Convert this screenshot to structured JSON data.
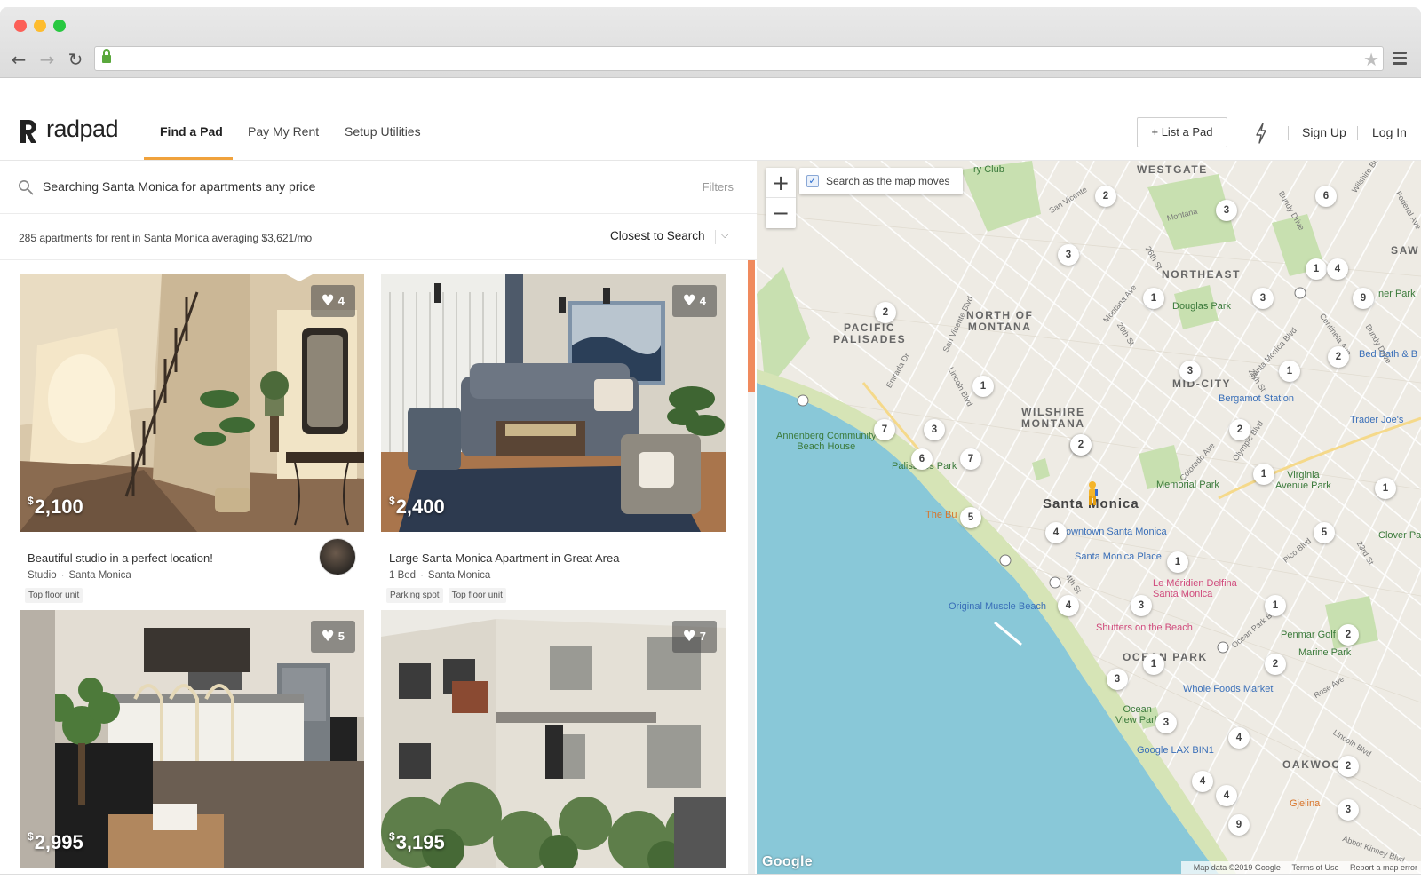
{
  "browser": {
    "url": "",
    "back_icon": "←",
    "forward_icon": "→",
    "reload_icon": "↻",
    "star_icon": "★"
  },
  "header": {
    "logo_text": "radpad",
    "nav": [
      {
        "label": "Find a Pad",
        "active": true
      },
      {
        "label": "Pay My Rent",
        "active": false
      },
      {
        "label": "Setup Utilities",
        "active": false
      }
    ],
    "list_button": "+ List a Pad",
    "sign_up": "Sign Up",
    "log_in": "Log In",
    "accent_color": "#f0a23c"
  },
  "search": {
    "text": "Searching Santa Monica for apartments any price",
    "filters_label": "Filters"
  },
  "summary": {
    "text": "285 apartments for rent in Santa Monica averaging $3,621/mo",
    "sort_label": "Closest to Search",
    "sort_chevron": "⌵"
  },
  "listings": [
    {
      "price_symbol": "$",
      "price": "2,100",
      "likes": "4",
      "title": "Beautiful studio in a perfect location!",
      "beds": "Studio",
      "area": "Santa Monica",
      "tags": [
        "Top floor unit"
      ],
      "has_agent": true
    },
    {
      "price_symbol": "$",
      "price": "2,400",
      "likes": "4",
      "title": "Large Santa Monica Apartment in Great Area",
      "beds": "1 Bed",
      "area": "Santa Monica",
      "tags": [
        "Parking spot",
        "Top floor unit"
      ],
      "has_agent": false
    },
    {
      "price_symbol": "$",
      "price": "2,995",
      "likes": "5",
      "title": "",
      "beds": "",
      "area": "",
      "tags": [],
      "has_agent": false
    },
    {
      "price_symbol": "$",
      "price": "3,195",
      "likes": "7",
      "title": "",
      "beds": "",
      "area": "",
      "tags": [],
      "has_agent": false
    }
  ],
  "map": {
    "zoom_in": "+",
    "zoom_out": "−",
    "search_as_moves": "Search as the map moves",
    "search_as_moves_checked": true,
    "check_glyph": "✓",
    "neighborhoods": [
      {
        "text": "WESTGATE"
      },
      {
        "text": "NORTHEAST"
      },
      {
        "text": "PACIFIC\nPALISADES"
      },
      {
        "text": "NORTH OF\nMONTANA"
      },
      {
        "text": "MID-CITY"
      },
      {
        "text": "WILSHIRE\nMONTANA"
      },
      {
        "text": "OCEAN PARK"
      },
      {
        "text": "OAKWOOD"
      },
      {
        "text": "SAW"
      }
    ],
    "city_label": "Santa Monica",
    "pois": [
      {
        "text": "Douglas Park",
        "color": "green"
      },
      {
        "text": "Bergamot Station",
        "color": "blue"
      },
      {
        "text": "Trader Joe's",
        "color": "blue"
      },
      {
        "text": "Annenberg Community\nBeach House",
        "color": "green"
      },
      {
        "text": "Palisades Park",
        "color": "green"
      },
      {
        "text": "Memorial Park",
        "color": "green"
      },
      {
        "text": "Virginia\nAvenue Park",
        "color": "green"
      },
      {
        "text": "Downtown Santa Monica",
        "color": "blue"
      },
      {
        "text": "Santa Monica Place",
        "color": "blue"
      },
      {
        "text": "Le Méridien Delfina\nSanta Monica",
        "color": "pink"
      },
      {
        "text": "Original Muscle Beach",
        "color": "blue"
      },
      {
        "text": "Shutters on the Beach",
        "color": "pink"
      },
      {
        "text": "Penmar Golf C",
        "color": "green"
      },
      {
        "text": "Marine Park",
        "color": "green"
      },
      {
        "text": "Whole Foods Market",
        "color": "blue"
      },
      {
        "text": "Ocean\nView Park",
        "color": "green"
      },
      {
        "text": "Google LAX BIN1",
        "color": "blue"
      },
      {
        "text": "Gjelina",
        "color": "orange"
      },
      {
        "text": "Clover Pa",
        "color": "green"
      },
      {
        "text": "Bed Bath & B",
        "color": "blue"
      },
      {
        "text": "ner Park",
        "color": "green"
      },
      {
        "text": "The Bu",
        "color": "orange"
      },
      {
        "text": "ry Club",
        "color": "green"
      }
    ],
    "clusters": [
      "2",
      "3",
      "6",
      "3",
      "1",
      "4",
      "1",
      "3",
      "9",
      "2",
      "2",
      "1",
      "3",
      "1",
      "3",
      "7",
      "3",
      "6",
      "7",
      "2",
      "2",
      "5",
      "4",
      "1",
      "1",
      "5",
      "1",
      "4",
      "3",
      "1",
      "2",
      "2",
      "3",
      "1",
      "3",
      "4",
      "2",
      "4",
      "4",
      "9",
      "3"
    ],
    "streets": [
      "San Vicente",
      "Montana",
      "26th St",
      "Bundy Drive",
      "Wilshire Blvd",
      "Entrada Dr",
      "San Vicente Blvd",
      "Montana Ave",
      "Lincoln Blvd",
      "20th St",
      "Santa Monica Blvd",
      "26th St",
      "Olympic Blvd",
      "Colorado Ave",
      "Pico Blvd",
      "4th St",
      "Ocean Park Blvd",
      "Rose Ave",
      "Lincoln Blvd",
      "23rd St",
      "Centinela Ave",
      "Federal Ave",
      "Bundy Drive",
      "Abbot Kinney Blvd"
    ],
    "google_logo": "Google",
    "footer": [
      "Map data ©2019 Google",
      "Terms of Use",
      "Report a map error"
    ]
  },
  "colors": {
    "water": "#89c8d8",
    "land": "#eeebe4",
    "park": "#c8e0b0",
    "road": "#ffffff",
    "scroll_thumb": "#f08a5d"
  }
}
